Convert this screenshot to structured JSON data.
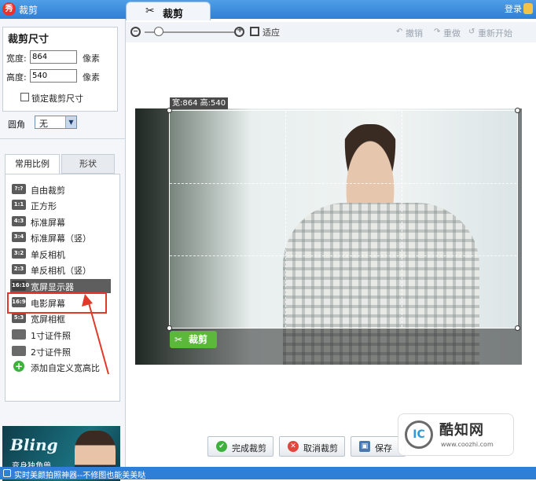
{
  "app": {
    "logo_text": "秀",
    "title": "裁剪",
    "login": "登录"
  },
  "main_tab": {
    "label": "裁剪"
  },
  "size": {
    "title": "裁剪尺寸",
    "width_label": "宽度:",
    "width_value": "864",
    "height_label": "高度:",
    "height_value": "540",
    "unit": "像素",
    "lock_label": "锁定裁剪尺寸",
    "round_label": "圆角",
    "round_value": "无"
  },
  "tabs": {
    "common": "常用比例",
    "shape": "形状"
  },
  "ratios": [
    {
      "badge": "?:?",
      "label": "自由裁剪"
    },
    {
      "badge": "1:1",
      "label": "正方形"
    },
    {
      "badge": "4:3",
      "label": "标准屏幕"
    },
    {
      "badge": "3:4",
      "label": "标准屏幕（竖）"
    },
    {
      "badge": "3:2",
      "label": "单反相机"
    },
    {
      "badge": "2:3",
      "label": "单反相机（竖）"
    },
    {
      "badge": "16:10",
      "label": "宽屏显示器"
    },
    {
      "badge": "16:9",
      "label": "电影屏幕"
    },
    {
      "badge": "5:3",
      "label": "宽屏相框"
    },
    {
      "badge": "",
      "label": "1寸证件照"
    },
    {
      "badge": "",
      "label": "2寸证件照"
    },
    {
      "badge": "+",
      "label": "添加自定义宽高比"
    }
  ],
  "ad": {
    "title": "Bling",
    "subtitle": "变身独角兽"
  },
  "toolbar": {
    "fit": "适应",
    "undo": "撤销",
    "redo": "重做",
    "restart": "重新开始"
  },
  "crop": {
    "dimension_label": "宽:864 高:540",
    "button": "裁剪"
  },
  "bottom": {
    "finish": "完成裁剪",
    "cancel": "取消裁剪",
    "save": "保存"
  },
  "watermark": {
    "logo": "IC",
    "name": "酷知网",
    "url": "www.coozhi.com"
  },
  "status": {
    "text": "实时美颜拍照神器--不修图也能美美哒"
  },
  "colors": {
    "accent": "#2f7fd6",
    "selected": "#5e5e5e",
    "highlight": "#e23a2a",
    "crop_green": "#5cb83a"
  }
}
